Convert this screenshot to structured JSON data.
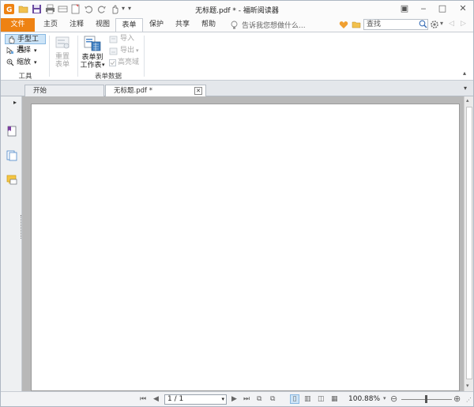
{
  "window": {
    "title": "无标题.pdf * - 福昕阅读器"
  },
  "menu_tabs": [
    {
      "label": "文件"
    },
    {
      "label": "主页"
    },
    {
      "label": "注释"
    },
    {
      "label": "视图"
    },
    {
      "label": "表单"
    },
    {
      "label": "保护"
    },
    {
      "label": "共享"
    },
    {
      "label": "帮助"
    }
  ],
  "tell_me": {
    "placeholder": "告诉我您想做什么..."
  },
  "search": {
    "placeholder": "查找"
  },
  "ribbon": {
    "tools": {
      "hand": "手型工具",
      "select": "选择",
      "zoom": "缩放",
      "group_label": "工具"
    },
    "form_data": {
      "reset_line1": "重置",
      "reset_line2": "表单",
      "to_sheet_line1": "表单到",
      "to_sheet_line2": "工作表",
      "import": "导入",
      "export": "导出",
      "highlight": "高亮域",
      "group_label": "表单数据"
    }
  },
  "doc_tabs": [
    {
      "label": "开始"
    },
    {
      "label": "无标题.pdf *"
    }
  ],
  "status": {
    "page": "1 / 1",
    "zoom": "100.88%"
  },
  "colors": {
    "accent": "#ee8213",
    "selected": "#cde4f7"
  }
}
